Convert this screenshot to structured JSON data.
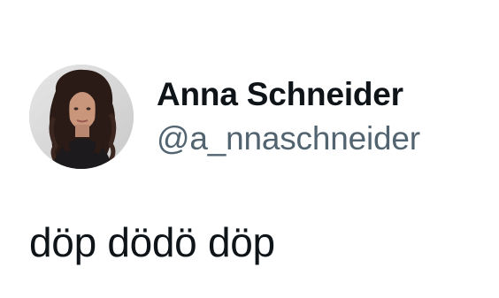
{
  "tweet": {
    "author": {
      "display_name": "Anna Schneider",
      "handle": "@a_nnaschneider",
      "avatar_icon": "profile-photo-avatar"
    },
    "text": "döp dödö döp"
  },
  "colors": {
    "background": "#ffffff",
    "name_text": "#0f1419",
    "handle_text": "#536471",
    "body_text": "#0f1419"
  }
}
